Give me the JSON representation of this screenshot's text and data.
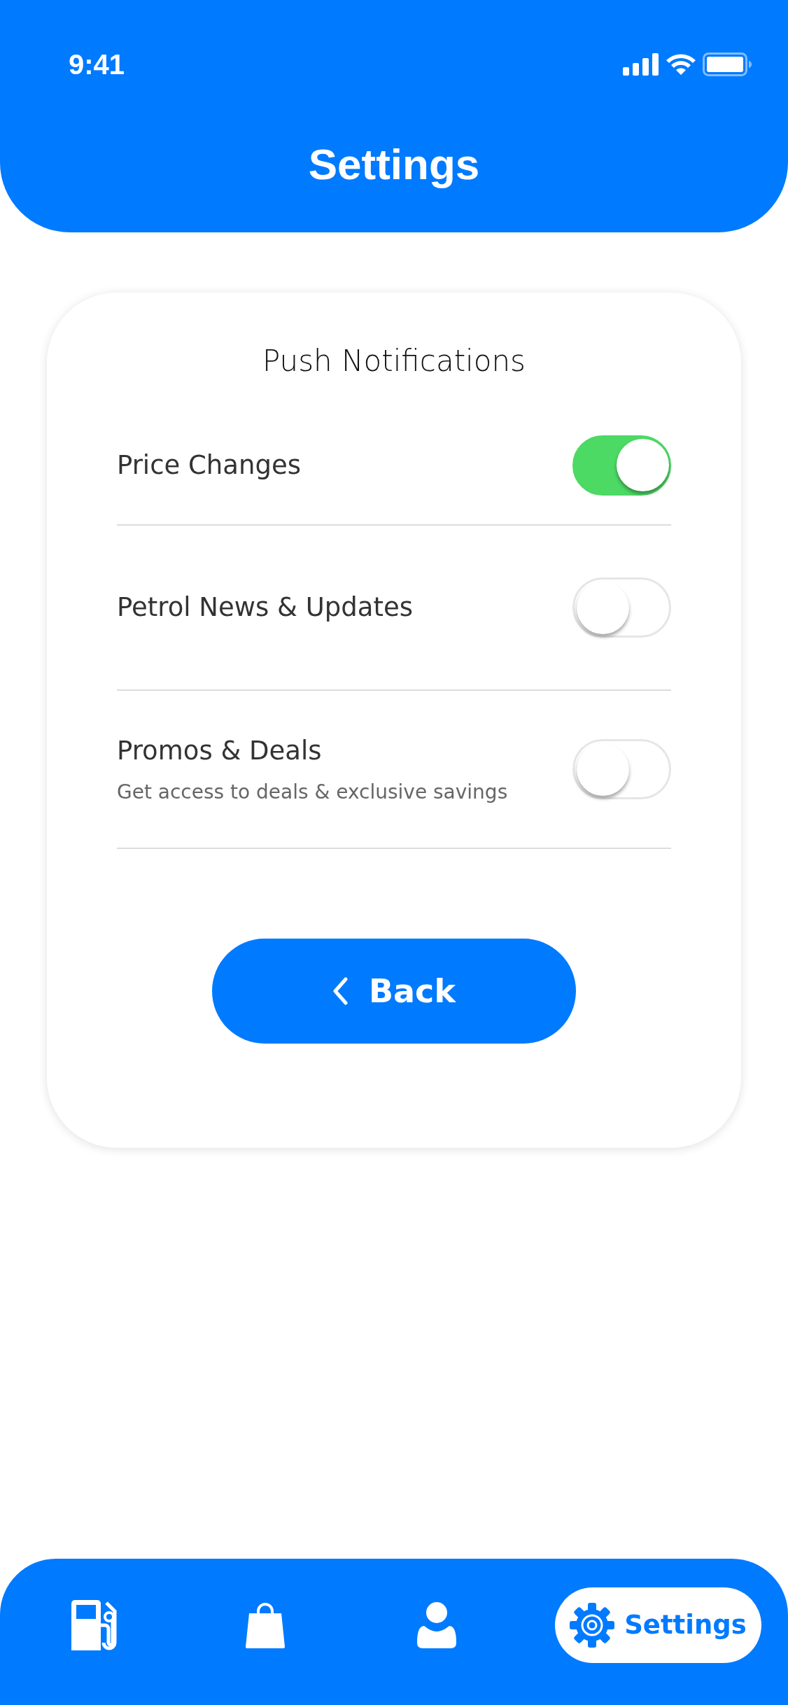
{
  "status_bar": {
    "time": "9:41"
  },
  "header": {
    "title": "Settings"
  },
  "card": {
    "title": "Push Notifications",
    "settings": [
      {
        "label": "Price Changes",
        "on": true
      },
      {
        "label": "Petrol News & Updates",
        "on": false
      },
      {
        "label": "Promos & Deals",
        "description": "Get access to deals & exclusive savings",
        "on": false
      }
    ],
    "back_button": {
      "label": "Back"
    }
  },
  "tab_bar": [
    {
      "kind": "fuel",
      "selected": false
    },
    {
      "kind": "bag",
      "selected": false
    },
    {
      "kind": "person",
      "selected": false
    },
    {
      "kind": "gear",
      "label": "Settings",
      "selected": true
    }
  ]
}
